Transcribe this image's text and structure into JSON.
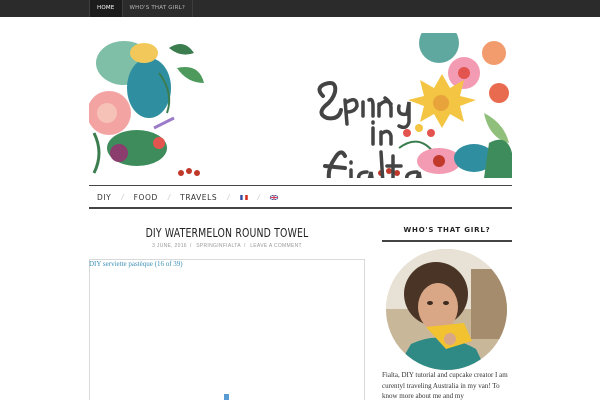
{
  "topnav": {
    "items": [
      {
        "label": "HOME",
        "active": true
      },
      {
        "label": "WHO'S THAT GIRL?",
        "active": false
      }
    ]
  },
  "site": {
    "logo_text": "Spring in Fialta"
  },
  "mainnav": {
    "items": [
      "DIY",
      "FOOD",
      "TRAVELS"
    ],
    "languages": [
      "fr",
      "en"
    ]
  },
  "post": {
    "title": "DIY WATERMELON ROUND TOWEL",
    "date": "3 JUNE, 2016",
    "author": "SPRINGINFIALTA",
    "comments": "LEAVE A COMMENT",
    "image_alt": "DIY serviette pastèque (16 of 39)"
  },
  "sidebar": {
    "widget_title": "WHO'S THAT GIRL?",
    "bio": "Fialta, DIY tutorial and cupcake creator I am curentyl traveling Australia in my van! To know more about me and my"
  },
  "colors": {
    "topbar": "#2b2b2b",
    "link": "#3a8fb7",
    "rule": "#444444"
  }
}
